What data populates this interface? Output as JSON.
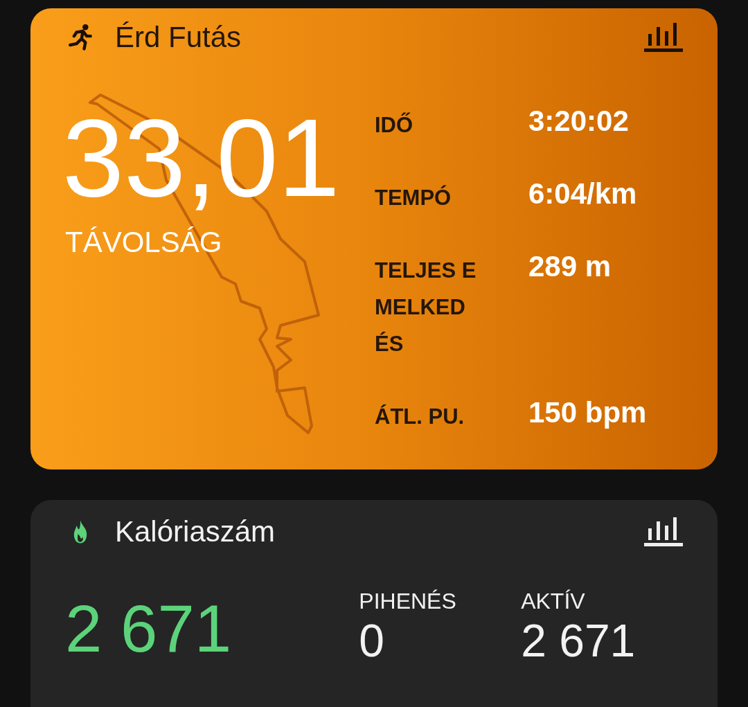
{
  "activity_card": {
    "title": "Érd Futás",
    "distance": {
      "value": "33,01",
      "label": "TÁVOLSÁG"
    },
    "stats": [
      {
        "label": "IDŐ",
        "value": "3:20:02"
      },
      {
        "label": "TEMPÓ",
        "value": "6:04/km"
      },
      {
        "label": "TELJES EMELKEDÉS",
        "value": "289 m"
      },
      {
        "label": "ÁTL. PU.",
        "value": "150 bpm"
      }
    ]
  },
  "calorie_card": {
    "title": "Kalóriaszám",
    "total": "2 671",
    "parts": [
      {
        "label": "PIHENÉS",
        "value": "0"
      },
      {
        "label": "AKTÍV",
        "value": "2 671"
      }
    ]
  }
}
